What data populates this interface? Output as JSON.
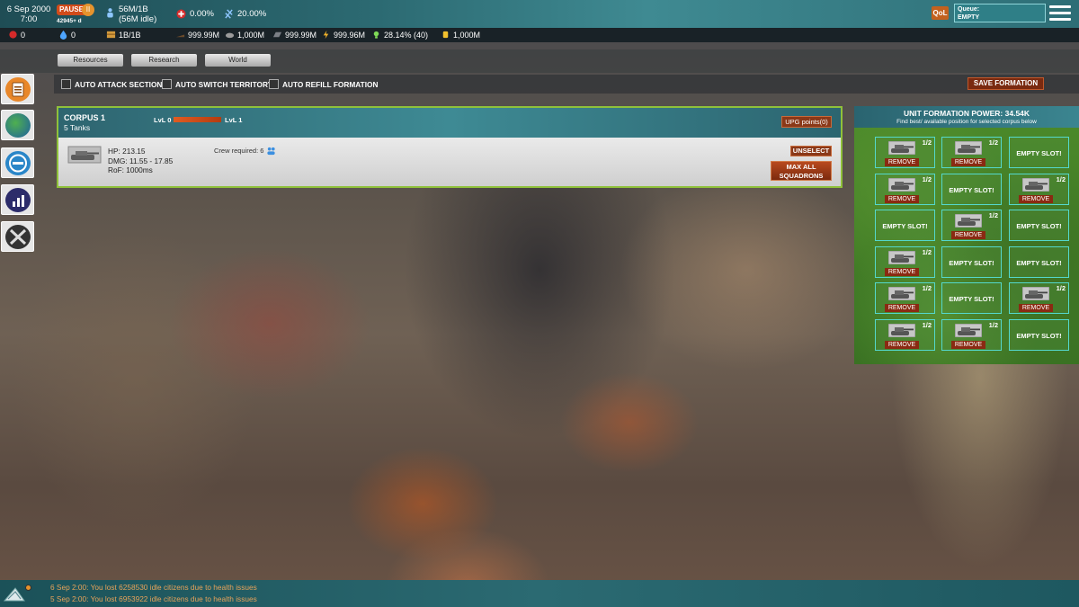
{
  "topbar": {
    "date": "6 Sep 2000",
    "time": "7:00",
    "pause_label": "PAUSE",
    "pause_icon": "II",
    "pause_sub": "42945+ d",
    "population": "56M/1B",
    "population_idle": "(56M idle)",
    "health": "0.00%",
    "growth": "20.00%",
    "qol_label": "QoL",
    "queue_label": "Queue:",
    "queue_value": "EMPTY"
  },
  "resources": [
    {
      "icon": "red-flag-icon",
      "value": "0"
    },
    {
      "icon": "blue-drop-icon",
      "value": "0"
    },
    {
      "icon": "crate-icon",
      "value": "1B/1B"
    },
    {
      "icon": "oil-icon",
      "value": "999.99M"
    },
    {
      "icon": "stone-icon",
      "value": "1,000M"
    },
    {
      "icon": "metal-icon",
      "value": "999.99M"
    },
    {
      "icon": "lightning-icon",
      "value": "999.96M"
    },
    {
      "icon": "lightbulb-icon",
      "value": "28.14% (40)"
    },
    {
      "icon": "gold-coins-icon",
      "value": "1,000M"
    }
  ],
  "nav": {
    "tabs": [
      "Resources",
      "Research",
      "World"
    ]
  },
  "options": {
    "auto_attack": "AUTO ATTACK SECTIONS",
    "auto_switch": "AUTO SWITCH TERRITORY",
    "auto_refill": "AUTO REFILL FORMATION",
    "save_formation": "SAVE FORMATION"
  },
  "corpus": {
    "title": "CORPUS 1",
    "subtitle": "5 Tanks",
    "lvl_from": "LvL 0",
    "lvl_to": "LvL 1",
    "upg_points": "UPG points(0)",
    "hp": "HP: 213.15",
    "dmg": "DMG: 11.55 - 17.85",
    "rof": "RoF: 1000ms",
    "crew": "Crew required: 6",
    "unselect": "UNSELECT",
    "max_all_1": "MAX ALL",
    "max_all_2": "SQUADRONS"
  },
  "formation": {
    "title": "UNIT FORMATION POWER: 34.54K",
    "subtitle": "Find best/ available position for selected corpus below",
    "remove_label": "REMOVE",
    "empty_label": "EMPTY SLOT!",
    "slots": [
      [
        "1/2",
        "1/2",
        "EMPTY"
      ],
      [
        "1/2",
        "EMPTY",
        "1/2"
      ],
      [
        "EMPTY",
        "1/2",
        "EMPTY"
      ],
      [
        "1/2",
        "EMPTY",
        "EMPTY"
      ],
      [
        "1/2",
        "EMPTY",
        "1/2"
      ],
      [
        "1/2",
        "1/2",
        "EMPTY"
      ]
    ]
  },
  "log": {
    "lines": [
      "6 Sep 2:00: You lost 6258530 idle citizens due to health issues",
      "5 Sep 2:00: You lost 6953922 idle citizens due to health issues"
    ]
  },
  "colors": {
    "accent_orange": "#d14b1a",
    "teal": "#2f7f87",
    "slot_border": "#54d8cc",
    "selected_border": "#8fc13a"
  }
}
